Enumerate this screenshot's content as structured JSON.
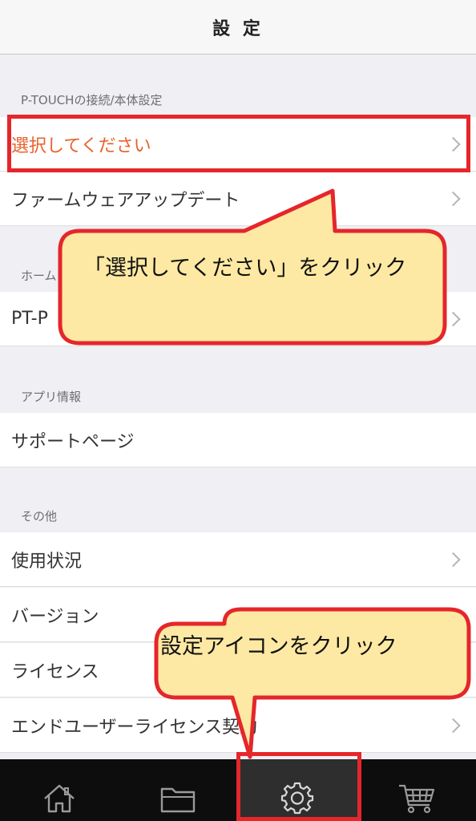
{
  "header": {
    "title": "設 定"
  },
  "sections": {
    "ptouch": "P-TOUCHの接続/本体設定",
    "home": "ホーム",
    "app_info": "アプリ情報",
    "other": "その他"
  },
  "rows": {
    "select": "選択してください",
    "firmware": "ファームウェアアップデート",
    "ptp": "PT-P",
    "support": "サポートページ",
    "usage": "使用状況",
    "version": "バージョン",
    "license": "ライセンス",
    "eula": "エンドユーザーライセンス契約"
  },
  "callouts": {
    "select_hint": "「選択してください」をクリック",
    "settings_hint": "設定アイコンをクリック"
  },
  "tabs": [
    {
      "icon": "home-icon"
    },
    {
      "icon": "folder-icon"
    },
    {
      "icon": "gear-icon",
      "active": true
    },
    {
      "icon": "cart-icon"
    }
  ],
  "colors": {
    "accent": "#e8602c",
    "highlight": "#e5262b",
    "callout_fill": "#fde9a3"
  }
}
